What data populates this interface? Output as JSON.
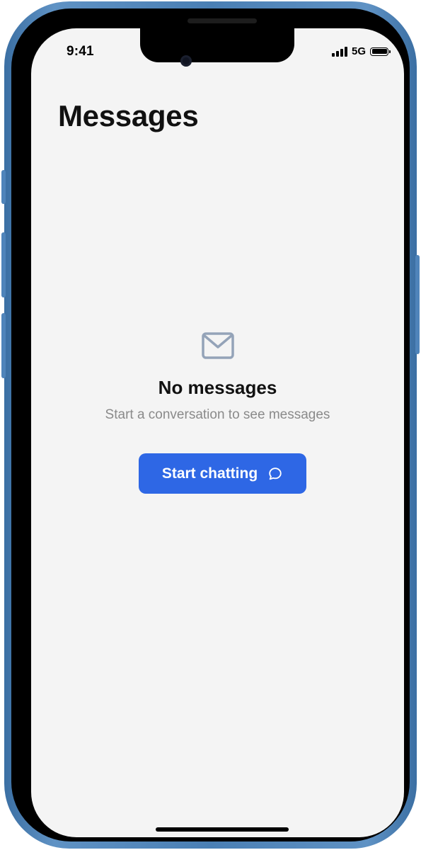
{
  "status_bar": {
    "time": "9:41",
    "network": "5G"
  },
  "header": {
    "title": "Messages"
  },
  "empty_state": {
    "icon": "mail-icon",
    "title": "No messages",
    "subtitle": "Start a conversation to see messages",
    "cta_label": "Start chatting",
    "cta_icon": "chat-bubble-icon"
  },
  "colors": {
    "accent": "#2e67e5",
    "icon_muted": "#94a3b8",
    "background": "#f4f4f4",
    "frame": "#4a7fb4"
  }
}
